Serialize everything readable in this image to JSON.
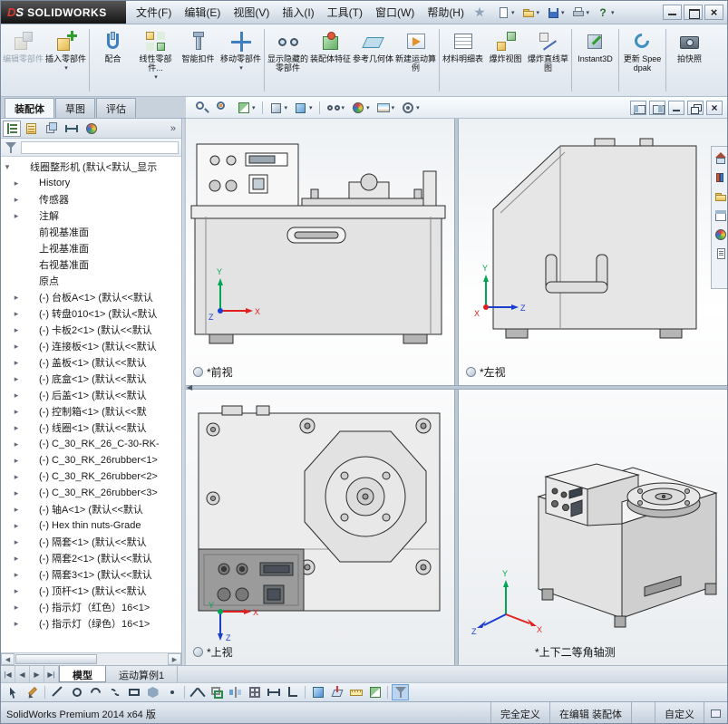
{
  "titlebar": {
    "logo_prefix": "DS",
    "logo_text": "SOLIDWORKS",
    "menus": [
      "文件(F)",
      "编辑(E)",
      "视图(V)",
      "插入(I)",
      "工具(T)",
      "窗口(W)",
      "帮助(H)"
    ],
    "quick_access": [
      {
        "icon": "new-document",
        "dd": true
      },
      {
        "icon": "open",
        "dd": true
      },
      {
        "icon": "save",
        "dd": true
      },
      {
        "icon": "print",
        "dd": true
      },
      {
        "icon": "help",
        "dd": true
      }
    ]
  },
  "command_bar": {
    "buttons": [
      {
        "label": "编辑零部件",
        "icon": "edit-component",
        "disabled": true
      },
      {
        "label": "插入零部件",
        "icon": "insert-component",
        "dd": true
      },
      {
        "sep": true
      },
      {
        "label": "配合",
        "icon": "mate"
      },
      {
        "label": "线性零部件...",
        "icon": "linear-component-pattern",
        "dd": true
      },
      {
        "label": "智能扣件",
        "icon": "smart-fasteners"
      },
      {
        "label": "移动零部件",
        "icon": "move-component",
        "dd": true
      },
      {
        "sep": true
      },
      {
        "label": "显示隐藏的零部件",
        "icon": "show-hidden-components"
      },
      {
        "label": "装配体特征",
        "icon": "assembly-features"
      },
      {
        "label": "参考几何体",
        "icon": "reference-geometry"
      },
      {
        "label": "新建运动算例",
        "icon": "new-motion-study"
      },
      {
        "sep": true
      },
      {
        "label": "材料明细表",
        "icon": "bill-of-materials"
      },
      {
        "label": "爆炸视图",
        "icon": "exploded-view"
      },
      {
        "label": "爆炸直线草图",
        "icon": "explode-line-sketch"
      },
      {
        "sep": true
      },
      {
        "label": "Instant3D",
        "icon": "instant3d"
      },
      {
        "sep": true
      },
      {
        "label": "更新 Speedpak",
        "icon": "update-speedpak"
      },
      {
        "sep": true
      },
      {
        "label": "拍快照",
        "icon": "take-snapshot"
      }
    ]
  },
  "ribbon": {
    "tabs": [
      {
        "label": "装配体",
        "active": true
      },
      {
        "label": "草图"
      },
      {
        "label": "评估"
      }
    ]
  },
  "view_toolbar": {
    "icons": [
      {
        "icon": "zoom-area"
      },
      {
        "icon": "zoom-fit"
      },
      {
        "icon": "section-view",
        "dd": true
      },
      {
        "sep": true
      },
      {
        "icon": "view-orientation",
        "dd": true
      },
      {
        "icon": "display-style",
        "dd": true
      },
      {
        "sep": true
      },
      {
        "icon": "hide-show-items",
        "dd": true
      },
      {
        "icon": "edit-appearance",
        "dd": true
      },
      {
        "icon": "apply-scene",
        "dd": true
      },
      {
        "icon": "view-settings",
        "dd": true
      }
    ]
  },
  "feature_panel": {
    "tabs": [
      {
        "icon": "feature-manager",
        "active": true
      },
      {
        "icon": "property-manager"
      },
      {
        "icon": "configuration-manager"
      },
      {
        "icon": "dimxpert-manager"
      },
      {
        "icon": "display-manager"
      }
    ],
    "overflow": "»",
    "tree": [
      {
        "icon": "assembly",
        "label": "线圈整形机 (默认<默认_显示",
        "root": true,
        "expand": "open"
      },
      {
        "icon": "history",
        "label": "History",
        "expand": "closed"
      },
      {
        "icon": "sensors",
        "label": "传感器",
        "expand": "closed"
      },
      {
        "icon": "annotations",
        "label": "注解",
        "expand": "closed"
      },
      {
        "icon": "plane",
        "label": "前视基准面"
      },
      {
        "icon": "plane",
        "label": "上视基准面"
      },
      {
        "icon": "plane",
        "label": "右视基准面"
      },
      {
        "icon": "origin",
        "label": "原点"
      },
      {
        "icon": "part",
        "label": "(-) 台板A<1> (默认<<默认",
        "expand": "closed"
      },
      {
        "icon": "part",
        "label": "(-) 转盘010<1> (默认<默认",
        "expand": "closed"
      },
      {
        "icon": "part",
        "label": "(-) 卡板2<1> (默认<<默认",
        "expand": "closed"
      },
      {
        "icon": "part",
        "label": "(-) 连接板<1> (默认<<默认",
        "expand": "closed"
      },
      {
        "icon": "part",
        "label": "(-) 盖板<1> (默认<<默认",
        "expand": "closed"
      },
      {
        "icon": "part",
        "label": "(-) 底盒<1> (默认<<默认",
        "expand": "closed"
      },
      {
        "icon": "part",
        "label": "(-) 后盖<1> (默认<<默认",
        "expand": "closed"
      },
      {
        "icon": "part",
        "label": "(-) 控制箱<1> (默认<<默",
        "expand": "closed"
      },
      {
        "icon": "part",
        "label": "(-) 线圈<1> (默认<<默认",
        "expand": "closed"
      },
      {
        "icon": "part",
        "label": "(-) C_30_RK_26_C-30-RK-",
        "expand": "closed"
      },
      {
        "icon": "part",
        "label": "(-) C_30_RK_26rubber<1>",
        "expand": "closed"
      },
      {
        "icon": "part",
        "label": "(-) C_30_RK_26rubber<2>",
        "expand": "closed"
      },
      {
        "icon": "part",
        "label": "(-) C_30_RK_26rubber<3>",
        "expand": "closed"
      },
      {
        "icon": "part",
        "label": "(-) 轴A<1> (默认<<默认",
        "expand": "closed"
      },
      {
        "icon": "part",
        "label": "(-) Hex thin nuts-Grade",
        "expand": "closed"
      },
      {
        "icon": "part",
        "label": "(-) 隔套<1> (默认<<默认",
        "expand": "closed"
      },
      {
        "icon": "part",
        "label": "(-) 隔套2<1> (默认<<默认",
        "expand": "closed"
      },
      {
        "icon": "part",
        "label": "(-) 隔套3<1> (默认<<默认",
        "expand": "closed"
      },
      {
        "icon": "part",
        "label": "(-) 顶杆<1> (默认<<默认",
        "expand": "closed"
      },
      {
        "icon": "part",
        "label": "(-) 指示灯（红色）16<1>",
        "expand": "closed"
      },
      {
        "icon": "part",
        "label": "(-) 指示灯（绿色）16<1>",
        "expand": "closed"
      }
    ]
  },
  "viewport": {
    "views": [
      {
        "label": "*前视"
      },
      {
        "label": "*左视"
      },
      {
        "label": "*上视"
      },
      {
        "label": "*上下二等角轴测"
      }
    ]
  },
  "task_pane": {
    "tabs": [
      {
        "icon": "resources"
      },
      {
        "icon": "design-library"
      },
      {
        "icon": "file-explorer"
      },
      {
        "icon": "view-palette"
      },
      {
        "icon": "appearances"
      },
      {
        "icon": "custom-properties"
      }
    ]
  },
  "model_tabs": {
    "tabs": [
      {
        "label": "模型",
        "active": true
      },
      {
        "label": "运动算例1"
      }
    ]
  },
  "sketch_bar": {
    "icons": [
      {
        "icon": "select"
      },
      {
        "icon": "sketch"
      },
      {
        "sep": true
      },
      {
        "icon": "line"
      },
      {
        "icon": "circle"
      },
      {
        "icon": "arc"
      },
      {
        "icon": "spline"
      },
      {
        "icon": "rectangle"
      },
      {
        "icon": "polygon"
      },
      {
        "icon": "point"
      },
      {
        "sep": true
      },
      {
        "icon": "trim"
      },
      {
        "icon": "convert-entities"
      },
      {
        "icon": "mirror-entities"
      },
      {
        "icon": "sketch-pattern"
      },
      {
        "icon": "smart-dimension"
      },
      {
        "icon": "add-relation"
      },
      {
        "sep": true
      },
      {
        "icon": "shaded-cube"
      },
      {
        "icon": "normal-to"
      },
      {
        "icon": "measure"
      },
      {
        "icon": "section-view"
      },
      {
        "sep": true
      },
      {
        "icon": "selection-filter",
        "active": true
      }
    ]
  },
  "statusbar": {
    "left": "SolidWorks Premium 2014 x64 版",
    "segments": [
      "完全定义",
      "在编辑 装配体",
      "",
      "自定义"
    ]
  }
}
